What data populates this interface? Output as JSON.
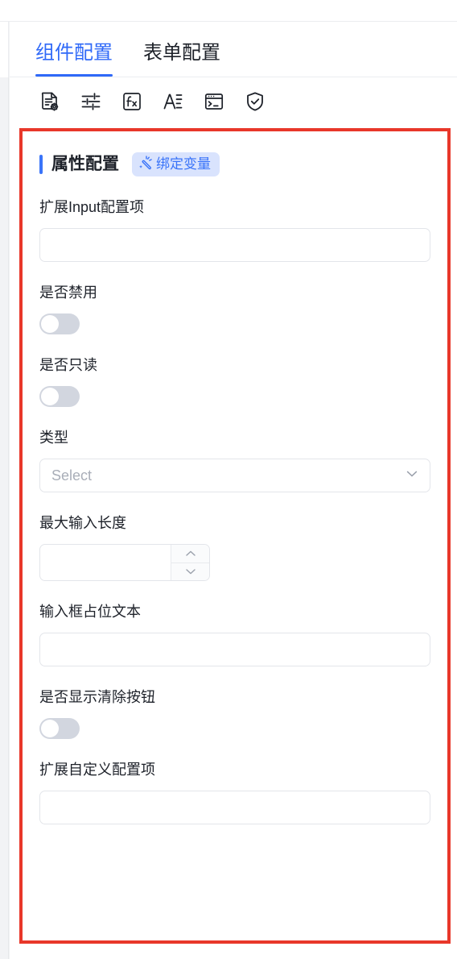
{
  "tabs": [
    {
      "label": "组件配置",
      "active": true
    },
    {
      "label": "表单配置",
      "active": false
    }
  ],
  "toolbar": {
    "icons": [
      {
        "name": "document-settings-icon",
        "title": "文档配置"
      },
      {
        "name": "sliders-icon",
        "title": "属性"
      },
      {
        "name": "function-fx-icon",
        "title": "函数"
      },
      {
        "name": "text-format-icon",
        "title": "文本"
      },
      {
        "name": "terminal-icon",
        "title": "终端"
      },
      {
        "name": "shield-check-icon",
        "title": "校验"
      }
    ]
  },
  "section": {
    "title": "属性配置",
    "badge_label": "绑定变量",
    "badge_icon": "magic-wand-icon",
    "accent_color": "#3a74f9",
    "badge_bg": "#d9e3fd"
  },
  "fields": [
    {
      "label": "扩展Input配置项",
      "type": "text",
      "value": "",
      "placeholder": ""
    },
    {
      "label": "是否禁用",
      "type": "switch",
      "value": false
    },
    {
      "label": "是否只读",
      "type": "switch",
      "value": false
    },
    {
      "label": "类型",
      "type": "select",
      "value": "",
      "placeholder": "Select"
    },
    {
      "label": "最大输入长度",
      "type": "number",
      "value": "",
      "placeholder": ""
    },
    {
      "label": "输入框占位文本",
      "type": "text",
      "value": "",
      "placeholder": ""
    },
    {
      "label": "是否显示清除按钮",
      "type": "switch",
      "value": false
    },
    {
      "label": "扩展自定义配置项",
      "type": "text",
      "value": "",
      "placeholder": ""
    }
  ],
  "annotation": {
    "name": "highlight-rectangle",
    "color": "#e8372a"
  }
}
